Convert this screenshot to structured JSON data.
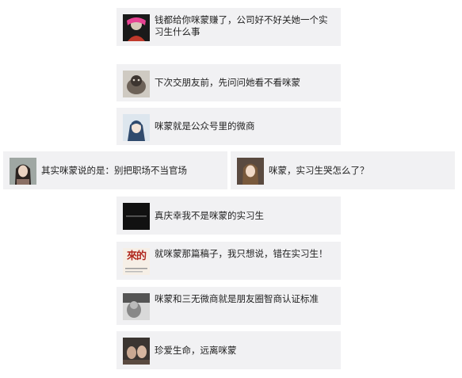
{
  "comments": [
    {
      "text": "钱都给你咪蒙赚了，公司好不好关她一个实习生什么事",
      "avatar": "rockstar-illustration-avatar"
    },
    {
      "text": "下次交朋友前，先问问她看不看咪蒙",
      "avatar": "cat-photo-avatar"
    },
    {
      "text": "咪蒙就是公众号里的微商",
      "avatar": "anime-character-avatar"
    },
    {
      "text": "其实咪蒙说的是：别把职场不当官场",
      "avatar": "girl-portrait-avatar"
    },
    {
      "text": "咪蒙，实习生哭怎么了？",
      "avatar": "woman-portrait-avatar"
    },
    {
      "text": "真庆幸我不是咪蒙的实习生",
      "avatar": "black-tile-avatar"
    },
    {
      "text": "就咪蒙那篇稿子，我只想说，错在实习生！",
      "avatar": "red-text-avatar",
      "avatar_text": "來的"
    },
    {
      "text": "咪蒙和三无微商就是朋友圈智商认证标准",
      "avatar": "grayscale-photo-avatar"
    },
    {
      "text": "珍爱生命，远离咪蒙",
      "avatar": "movie-still-avatar"
    }
  ]
}
